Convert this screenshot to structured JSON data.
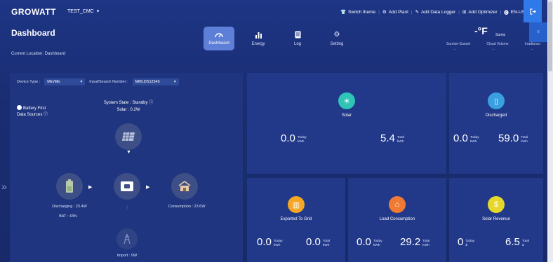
{
  "app": {
    "logo": "GROWATT",
    "plant_name": "TEST_CMC"
  },
  "topnav": {
    "switch_theme": "Switch theme",
    "add_plant": "Add Plant",
    "add_data_logger": "Add Data Logger",
    "add_optimizer": "Add Optimizer",
    "language": "EN-US"
  },
  "header": {
    "title": "Dashboard",
    "location": "Current Location: Dashboard"
  },
  "tabs": [
    {
      "label": "Dashboard",
      "icon": "gauge-icon",
      "active": true
    },
    {
      "label": "Energy",
      "icon": "bar-chart-icon",
      "active": false
    },
    {
      "label": "Log",
      "icon": "document-icon",
      "active": false
    },
    {
      "label": "Setting",
      "icon": "gear-icon",
      "active": false
    }
  ],
  "weather": {
    "temp": "-°F",
    "condition": "Sunny",
    "labels": [
      "Sunrise-Sunset",
      "Cloud Volume",
      "Irradiance"
    ],
    "values": [
      "--",
      "--",
      "--"
    ]
  },
  "device": {
    "type_label": "Device Type :",
    "type_value": "Min/Mic",
    "search_label": "Input/Search Number :",
    "search_value": "MMLDS12345"
  },
  "mode": {
    "option": "Battery First",
    "sources": "Data Sources ⓘ"
  },
  "flow": {
    "system_state": "System State : Standby ⓘ",
    "solar": "Solar : 0.2W",
    "discharging": "Discharging : 23.4W",
    "bat": "BAT : 43%",
    "consumption": "Consumption : 23.6W",
    "import": "Import : 0W"
  },
  "cards": {
    "solar": {
      "title": "Solar",
      "today_value": "0.0",
      "today_label": "Today",
      "today_unit": "kWh",
      "total_value": "5.4",
      "total_label": "Total",
      "total_unit": "kWh",
      "color": "#2ec4b6"
    },
    "discharged": {
      "title": "Discharged",
      "today_value": "0.0",
      "today_label": "Today",
      "today_unit": "kWh",
      "total_value": "59.0",
      "total_label": "Total",
      "total_unit": "kWh",
      "color": "#3aa0e0"
    },
    "exported": {
      "title": "Exported To Grid",
      "today_value": "0.0",
      "today_label": "Today",
      "today_unit": "kWh",
      "total_value": "0.0",
      "total_label": "Total",
      "total_unit": "kWh",
      "color": "#f5a623"
    },
    "load": {
      "title": "Load Consumption",
      "today_value": "0.0",
      "today_label": "Today",
      "today_unit": "kWh",
      "total_value": "29.2",
      "total_label": "Total",
      "total_unit": "kWh",
      "color": "#f07a34"
    },
    "revenue": {
      "title": "Solar Revenue",
      "today_value": "0",
      "today_label": "Today",
      "today_unit": "$",
      "total_value": "6.5",
      "total_label": "Total",
      "total_unit": "$",
      "color": "#e6d82a"
    }
  },
  "colors": {
    "accent": "#2f7ae8",
    "background": "#1b2e73",
    "card": "#22398a"
  }
}
